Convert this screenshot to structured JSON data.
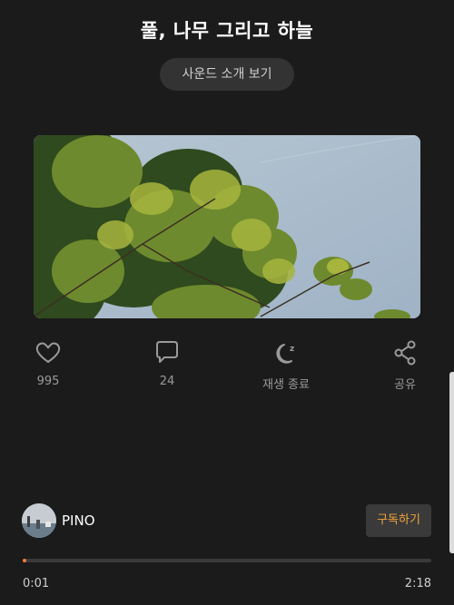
{
  "track": {
    "title": "풀, 나무 그리고 하늘",
    "intro_button_label": "사운드 소개 보기"
  },
  "artwork": {
    "description_icon": "tree-branches-sky-photo"
  },
  "actions": [
    {
      "icon": "heart-icon",
      "label": "995"
    },
    {
      "icon": "comment-icon",
      "label": "24"
    },
    {
      "icon": "sleep-timer-icon",
      "label": "재생 종료"
    },
    {
      "icon": "share-icon",
      "label": "공유"
    }
  ],
  "artist": {
    "name": "PINO",
    "subscribe_label": "구독하기"
  },
  "playback": {
    "elapsed": "0:01",
    "total": "2:18",
    "progress_fraction": 0.0072
  },
  "colors": {
    "background": "#1b1b1b",
    "accent": "#f07b3a",
    "subscribe_text": "#f2a33a"
  }
}
